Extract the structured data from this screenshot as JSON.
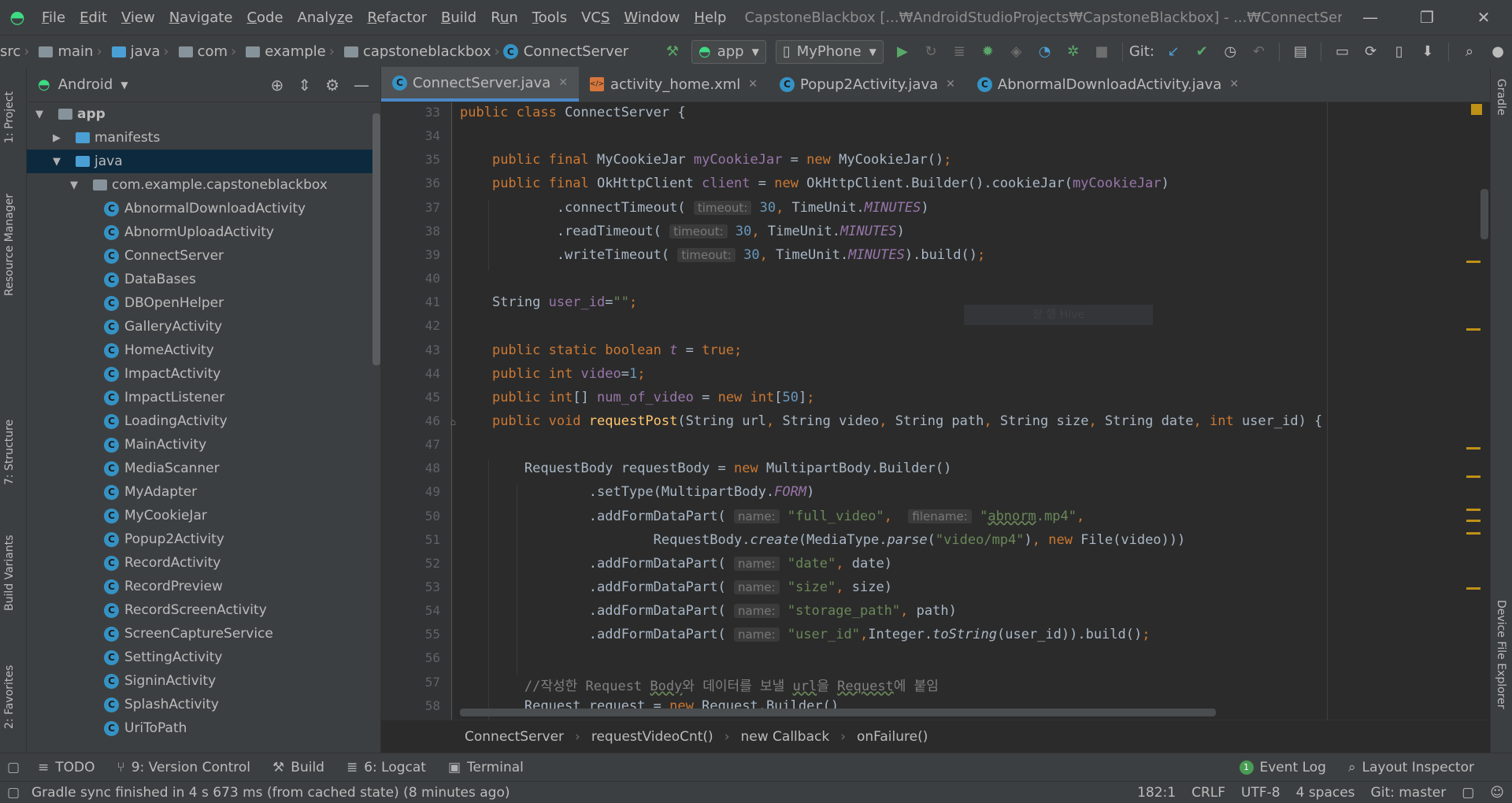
{
  "window": {
    "title": "CapstoneBlackbox [...₩AndroidStudioProjects₩CapstoneBlackbox] - ...₩ConnectServer.java [app]",
    "minimize": "—",
    "restore": "❐",
    "close": "✕"
  },
  "menu": [
    "File",
    "Edit",
    "View",
    "Navigate",
    "Code",
    "Analyze",
    "Refactor",
    "Build",
    "Run",
    "Tools",
    "VCS",
    "Window",
    "Help"
  ],
  "nav": {
    "crumbs": [
      "src",
      "main",
      "java",
      "com",
      "example",
      "capstoneblackbox",
      "ConnectServer"
    ],
    "run_config": "app",
    "device": "MyPhone",
    "git_label": "Git:"
  },
  "left_strip": [
    "1: Project",
    "Resource Manager",
    "7: Structure",
    "Build Variants",
    "2: Favorites"
  ],
  "right_strip": [
    "Gradle",
    "Device File Explorer"
  ],
  "project": {
    "view": "Android",
    "tree": [
      {
        "label": "app",
        "level": 0,
        "arrow": "▼",
        "kind": "module"
      },
      {
        "label": "manifests",
        "level": 1,
        "arrow": "▶",
        "kind": "folder"
      },
      {
        "label": "java",
        "level": 1,
        "arrow": "▼",
        "kind": "folder",
        "selected": true
      },
      {
        "label": "com.example.capstoneblackbox",
        "level": 2,
        "arrow": "▼",
        "kind": "package"
      },
      {
        "label": "AbnormalDownloadActivity",
        "level": 3,
        "kind": "class"
      },
      {
        "label": "AbnormUploadActivity",
        "level": 3,
        "kind": "class"
      },
      {
        "label": "ConnectServer",
        "level": 3,
        "kind": "class"
      },
      {
        "label": "DataBases",
        "level": 3,
        "kind": "class"
      },
      {
        "label": "DBOpenHelper",
        "level": 3,
        "kind": "class"
      },
      {
        "label": "GalleryActivity",
        "level": 3,
        "kind": "class"
      },
      {
        "label": "HomeActivity",
        "level": 3,
        "kind": "class"
      },
      {
        "label": "ImpactActivity",
        "level": 3,
        "kind": "class"
      },
      {
        "label": "ImpactListener",
        "level": 3,
        "kind": "class"
      },
      {
        "label": "LoadingActivity",
        "level": 3,
        "kind": "class"
      },
      {
        "label": "MainActivity",
        "level": 3,
        "kind": "class"
      },
      {
        "label": "MediaScanner",
        "level": 3,
        "kind": "class"
      },
      {
        "label": "MyAdapter",
        "level": 3,
        "kind": "class"
      },
      {
        "label": "MyCookieJar",
        "level": 3,
        "kind": "class"
      },
      {
        "label": "Popup2Activity",
        "level": 3,
        "kind": "class"
      },
      {
        "label": "RecordActivity",
        "level": 3,
        "kind": "class"
      },
      {
        "label": "RecordPreview",
        "level": 3,
        "kind": "class"
      },
      {
        "label": "RecordScreenActivity",
        "level": 3,
        "kind": "class"
      },
      {
        "label": "ScreenCaptureService",
        "level": 3,
        "kind": "class"
      },
      {
        "label": "SettingActivity",
        "level": 3,
        "kind": "class"
      },
      {
        "label": "SigninActivity",
        "level": 3,
        "kind": "class"
      },
      {
        "label": "SplashActivity",
        "level": 3,
        "kind": "class"
      },
      {
        "label": "UriToPath",
        "level": 3,
        "kind": "class"
      }
    ]
  },
  "tabs": [
    {
      "label": "ConnectServer.java",
      "kind": "class",
      "active": true
    },
    {
      "label": "activity_home.xml",
      "kind": "xml"
    },
    {
      "label": "Popup2Activity.java",
      "kind": "class"
    },
    {
      "label": "AbnormalDownloadActivity.java",
      "kind": "class"
    }
  ],
  "line_numbers": [
    "33",
    "34",
    "35",
    "36",
    "37",
    "38",
    "39",
    "40",
    "41",
    "42",
    "43",
    "44",
    "45",
    "46",
    "47",
    "48",
    "49",
    "50",
    "51",
    "52",
    "53",
    "54",
    "55",
    "56",
    "57",
    "58"
  ],
  "code_breadcrumb": [
    "ConnectServer",
    "requestVideoCnt()",
    "new Callback",
    "onFailure()"
  ],
  "tooltip": "장 행 Hive",
  "tool_windows": [
    {
      "icon": "≡",
      "label": "TODO"
    },
    {
      "icon": "⑂",
      "label": "9: Version Control"
    },
    {
      "icon": "⚒",
      "label": "Build"
    },
    {
      "icon": "≣",
      "label": "6: Logcat"
    },
    {
      "icon": "▣",
      "label": "Terminal"
    }
  ],
  "tool_windows_right": [
    {
      "icon": "1",
      "label": "Event Log"
    },
    {
      "icon": "⌕",
      "label": "Layout Inspector"
    }
  ],
  "status": {
    "message": "Gradle sync finished in 4 s 673 ms (from cached state) (8 minutes ago)",
    "position": "182:1",
    "line_sep": "CRLF",
    "encoding": "UTF-8",
    "indent": "4 spaces",
    "branch": "Git: master"
  },
  "colors": {
    "keyword": "#cc7832",
    "field": "#9876aa",
    "string": "#6a8759",
    "number": "#6897bb",
    "function": "#ffc66d",
    "accent": "#4a88c7"
  }
}
